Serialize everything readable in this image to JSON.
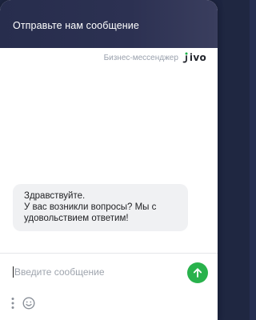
{
  "header": {
    "title": "Отправьте нам сообщение"
  },
  "branding": {
    "text": "Бизнес-мессенджер",
    "logo_text": "jivo"
  },
  "messages": [
    {
      "lines": [
        "Здравствуйте.",
        "У вас возникли вопросы? Мы с удовольствием ответим!"
      ]
    }
  ],
  "composer": {
    "placeholder": "Введите сообщение",
    "value": ""
  },
  "icons": {
    "send": "arrow-up-icon",
    "more": "vertical-dots-icon",
    "emoji": "smiley-icon"
  },
  "colors": {
    "header": "#2a2f4f",
    "accent": "#29b24c",
    "bubble": "#f0f1f3"
  }
}
